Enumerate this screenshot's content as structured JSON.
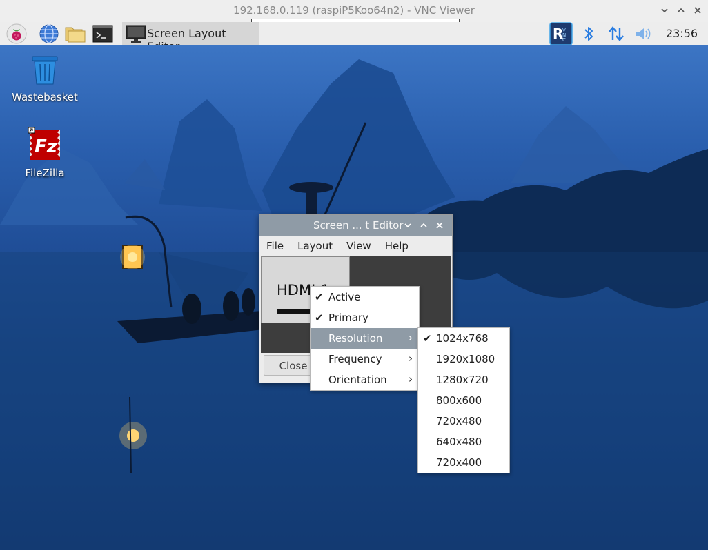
{
  "vnc": {
    "title": "192.168.0.119 (raspiP5Koo64n2) - VNC Viewer"
  },
  "taskbar": {
    "task_label": "Screen Layout Editor",
    "clock": "23:56",
    "launchers": [
      "raspberry-menu-icon",
      "web-browser-icon",
      "file-manager-icon",
      "terminal-icon"
    ],
    "tray_icons": [
      "realvnc-icon",
      "bluetooth-icon",
      "network-icon",
      "volume-icon"
    ]
  },
  "desktop": {
    "icons": [
      {
        "label": "Wastebasket",
        "icon": "wastebasket-icon"
      },
      {
        "label": "FileZilla",
        "icon": "filezilla-icon"
      }
    ]
  },
  "editor": {
    "title": "Screen ... t Editor",
    "menu": [
      "File",
      "Layout",
      "View",
      "Help"
    ],
    "monitor_name": "HDMI-1",
    "close_label": "Close"
  },
  "context_menu": {
    "items": [
      {
        "label": "Active",
        "checked": true,
        "submenu": false
      },
      {
        "label": "Primary",
        "checked": true,
        "submenu": false
      },
      {
        "label": "Resolution",
        "checked": false,
        "submenu": true,
        "selected": true
      },
      {
        "label": "Frequency",
        "checked": false,
        "submenu": true
      },
      {
        "label": "Orientation",
        "checked": false,
        "submenu": true
      }
    ]
  },
  "resolution_menu": {
    "items": [
      {
        "label": "1024x768",
        "checked": true
      },
      {
        "label": "1920x1080",
        "checked": false
      },
      {
        "label": "1280x720",
        "checked": false
      },
      {
        "label": "800x600",
        "checked": false
      },
      {
        "label": "720x480",
        "checked": false
      },
      {
        "label": "640x480",
        "checked": false
      },
      {
        "label": "720x400",
        "checked": false
      }
    ]
  },
  "colors": {
    "menu_highlight": "#8f9ba6",
    "window_titlebar": "#8f9ba6",
    "vnc_badge": "#1e3a6e"
  }
}
